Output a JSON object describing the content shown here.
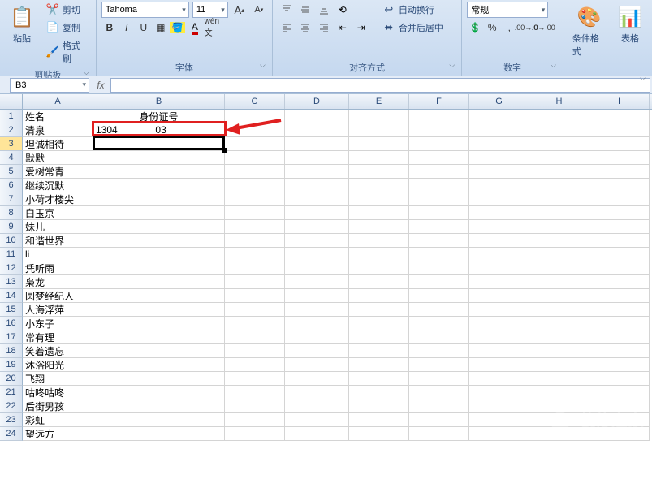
{
  "ribbon": {
    "clipboard": {
      "label": "剪贴板",
      "paste": "粘贴",
      "cut": "剪切",
      "copy": "复制",
      "format_painter": "格式刷"
    },
    "font": {
      "label": "字体",
      "name": "Tahoma",
      "size": "11"
    },
    "alignment": {
      "label": "对齐方式",
      "wrap": "自动换行",
      "merge": "合并后居中"
    },
    "number": {
      "label": "数字",
      "format": "常规"
    },
    "styles": {
      "cond_format": "条件格式",
      "more": "表格"
    }
  },
  "name_box": "B3",
  "columns": [
    "A",
    "B",
    "C",
    "D",
    "E",
    "F",
    "G",
    "H",
    "I"
  ],
  "chart_data": {
    "type": "table",
    "headers": {
      "A": "姓名",
      "B": "身份证号"
    },
    "rows": [
      {
        "row": 2,
        "A": "清泉",
        "B": "1304_______03___"
      },
      {
        "row": 3,
        "A": "坦诚相待",
        "B": ""
      },
      {
        "row": 4,
        "A": "默默",
        "B": ""
      },
      {
        "row": 5,
        "A": "爱树常青",
        "B": ""
      },
      {
        "row": 6,
        "A": "继续沉默",
        "B": ""
      },
      {
        "row": 7,
        "A": "小荷才楼尖",
        "B": ""
      },
      {
        "row": 8,
        "A": "白玉京",
        "B": ""
      },
      {
        "row": 9,
        "A": "妹儿",
        "B": ""
      },
      {
        "row": 10,
        "A": "和谐世界",
        "B": ""
      },
      {
        "row": 11,
        "A": "li",
        "B": ""
      },
      {
        "row": 12,
        "A": "凭听雨",
        "B": ""
      },
      {
        "row": 13,
        "A": "枭龙",
        "B": ""
      },
      {
        "row": 14,
        "A": "圆梦经纪人",
        "B": ""
      },
      {
        "row": 15,
        "A": "人海浮萍",
        "B": ""
      },
      {
        "row": 16,
        "A": "小东子",
        "B": ""
      },
      {
        "row": 17,
        "A": "常有理",
        "B": ""
      },
      {
        "row": 18,
        "A": "笑着遗忘",
        "B": ""
      },
      {
        "row": 19,
        "A": "沐浴阳光",
        "B": ""
      },
      {
        "row": 20,
        "A": "飞翔",
        "B": ""
      },
      {
        "row": 21,
        "A": "咕咚咕咚",
        "B": ""
      },
      {
        "row": 22,
        "A": "后街男孩",
        "B": ""
      },
      {
        "row": 23,
        "A": "彩虹",
        "B": ""
      },
      {
        "row": 24,
        "A": "望远方",
        "B": ""
      }
    ]
  },
  "selected_cell": "B3",
  "highlighted_cell": "B2"
}
